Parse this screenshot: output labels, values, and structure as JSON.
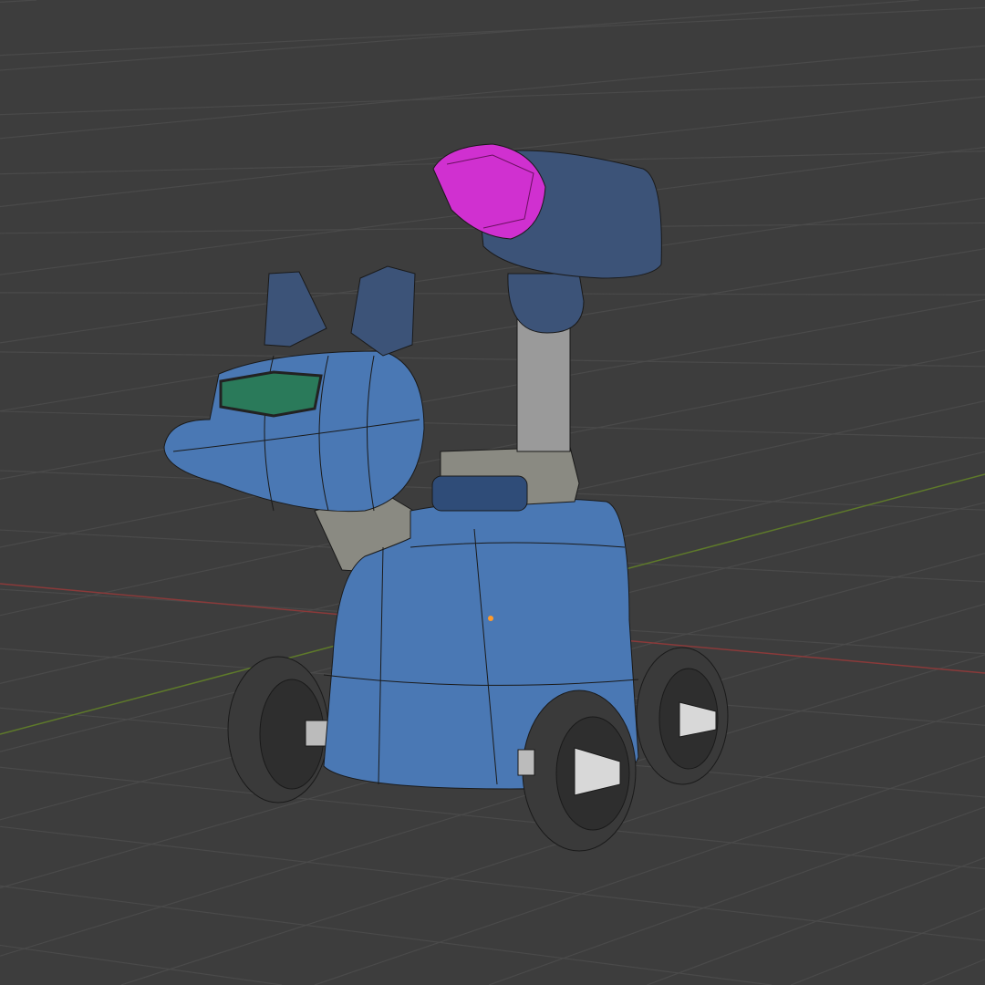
{
  "viewport": {
    "kind": "3d-viewport",
    "background_color": "#3d3d3d",
    "grid_color": "#4a4a4a",
    "x_axis_color": "#8a3a3a",
    "y_axis_color": "#5e7a2a"
  },
  "model": {
    "body_color": "#4a78b4",
    "dark_part_color": "#3c5378",
    "metal_color": "#9a9a9a",
    "eye_color": "#2a7a5a",
    "gem_color": "#d030d0",
    "tire_color": "#3a3a3a",
    "origin_dot_color": "#ff9a2a"
  }
}
